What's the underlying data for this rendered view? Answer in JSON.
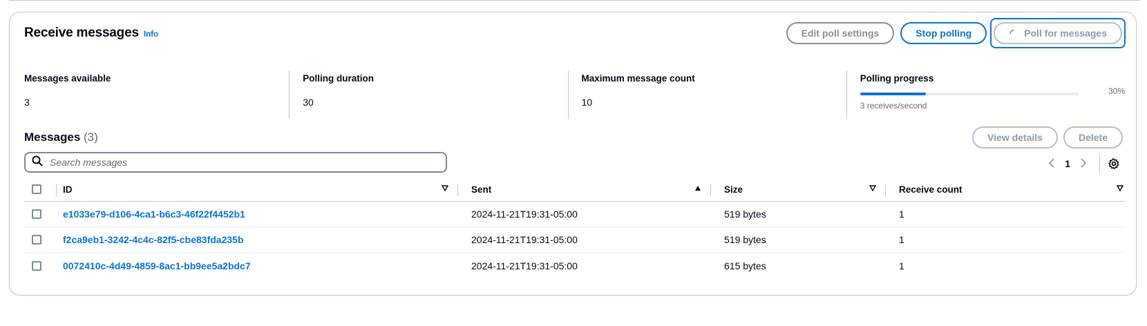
{
  "panel": {
    "title": "Receive messages",
    "info_label": "Info"
  },
  "actions": {
    "edit_poll_settings": "Edit poll settings",
    "stop_polling": "Stop polling",
    "poll_for_messages": "Poll for messages"
  },
  "stats": {
    "messages_available": {
      "label": "Messages available",
      "value": "3"
    },
    "polling_duration": {
      "label": "Polling duration",
      "value": "30"
    },
    "max_message_count": {
      "label": "Maximum message count",
      "value": "10"
    },
    "polling_progress": {
      "label": "Polling progress",
      "percent_label": "30%",
      "percent": 30,
      "description": "3 receives/second"
    }
  },
  "messages": {
    "title": "Messages",
    "count": "(3)",
    "view_details": "View details",
    "delete": "Delete",
    "search_placeholder": "Search messages",
    "page": "1",
    "columns": {
      "id": "ID",
      "sent": "Sent",
      "size": "Size",
      "receive_count": "Receive count"
    },
    "rows": [
      {
        "id": "e1033e79-d106-4ca1-b6c3-46f22f4452b1",
        "sent": "2024-11-21T19:31-05:00",
        "size": "519 bytes",
        "receive_count": "1"
      },
      {
        "id": "f2ca9eb1-3242-4c4c-82f5-cbe83fda235b",
        "sent": "2024-11-21T19:31-05:00",
        "size": "519 bytes",
        "receive_count": "1"
      },
      {
        "id": "0072410c-4d49-4859-8ac1-bb9ee5a2bdc7",
        "sent": "2024-11-21T19:31-05:00",
        "size": "615 bytes",
        "receive_count": "1"
      }
    ]
  },
  "colors": {
    "accent": "#0972d3",
    "text": "#000716",
    "muted": "#5f6b7a",
    "border": "#c6c6cd"
  },
  "icons": {
    "spinner": "spinner-icon",
    "search": "search-icon",
    "settings": "gear-icon",
    "prev": "chevron-left-icon",
    "next": "chevron-right-icon",
    "sort_desc": "caret-down-outline-icon",
    "sort_asc": "caret-up-filled-icon"
  }
}
